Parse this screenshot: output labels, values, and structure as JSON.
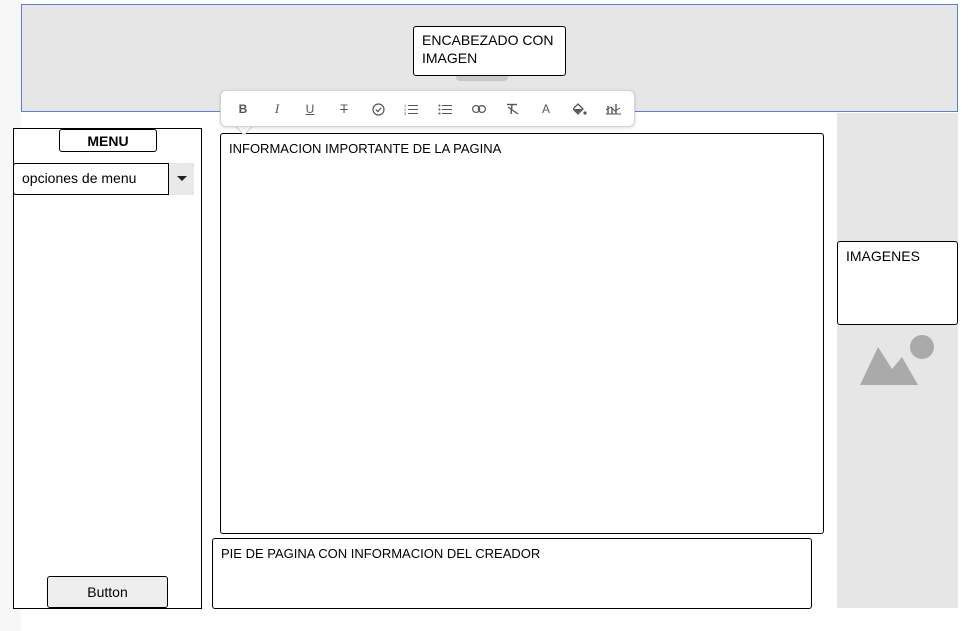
{
  "header": {
    "label": "ENCABEZADO CON IMAGEN"
  },
  "menu": {
    "title": "MENU",
    "select_value": "opciones de menu",
    "button_label": "Button"
  },
  "main": {
    "text": "INFORMACION IMPORTANTE DE LA PAGINA"
  },
  "footer": {
    "text": "PIE DE PAGINA CON INFORMACION DEL CREADOR"
  },
  "images": {
    "label": "IMAGENES"
  },
  "toolbar": {
    "items": [
      {
        "name": "bold",
        "glyph": "B"
      },
      {
        "name": "italic",
        "glyph": "I"
      },
      {
        "name": "underline",
        "glyph": "U"
      },
      {
        "name": "strikethrough",
        "glyph": "T"
      },
      {
        "name": "check",
        "glyph": "✓"
      },
      {
        "name": "ordered-list",
        "glyph": "≡"
      },
      {
        "name": "bullet-list",
        "glyph": "≡"
      },
      {
        "name": "link",
        "glyph": "∞"
      },
      {
        "name": "clear-format",
        "glyph": "T"
      },
      {
        "name": "font-color",
        "glyph": "A"
      },
      {
        "name": "fill-color",
        "glyph": "◆"
      },
      {
        "name": "chart",
        "glyph": "ılı"
      }
    ]
  },
  "colors": {
    "header_border": "#5b7fd6",
    "panel_gray": "#e6e6e6"
  }
}
